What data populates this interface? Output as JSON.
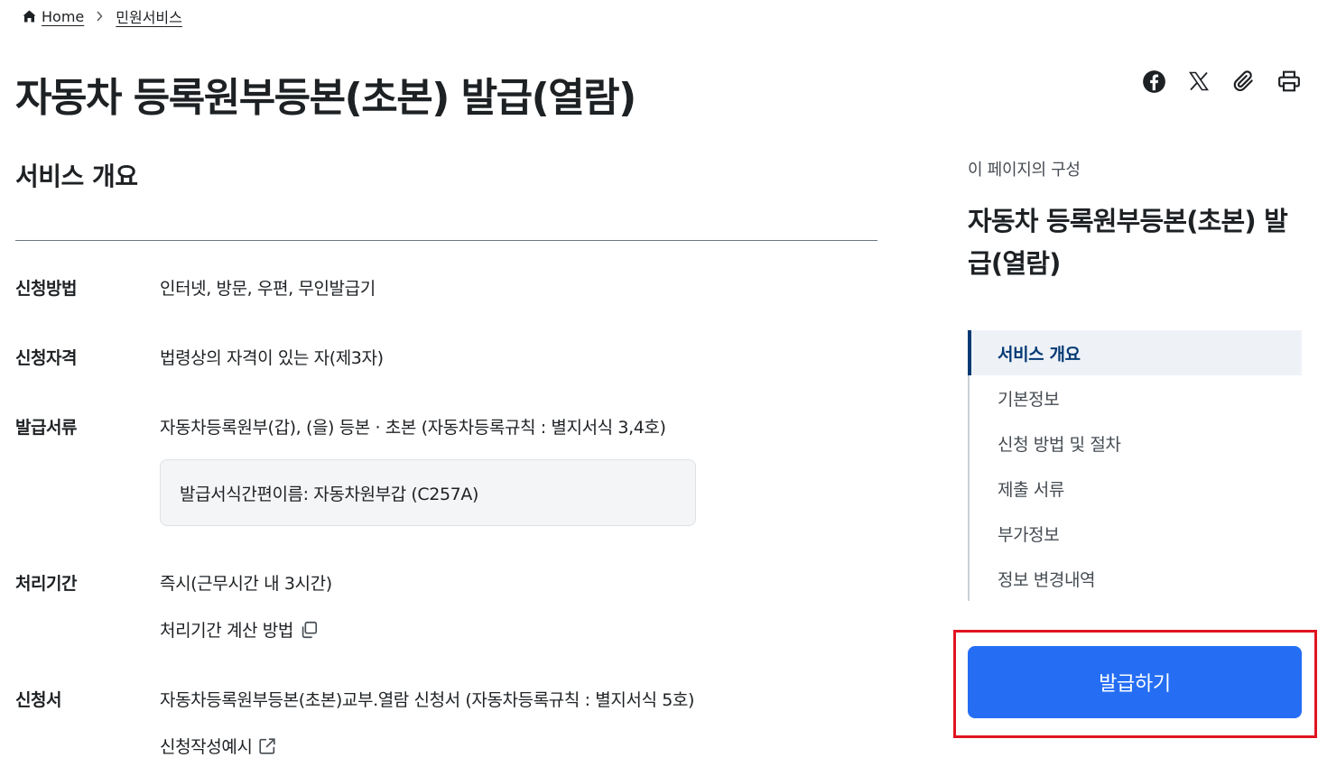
{
  "breadcrumb": {
    "home": "Home",
    "current": "민원서비스"
  },
  "page_title": "자동차 등록원부등본(초본) 발급(열람)",
  "share": {
    "icons": [
      "facebook-icon",
      "x-icon",
      "paperclip-icon",
      "print-icon"
    ]
  },
  "section": {
    "title": "서비스 개요",
    "rows": [
      {
        "label": "신청방법",
        "value": "인터넷, 방문, 우편, 무인발급기"
      },
      {
        "label": "신청자격",
        "value": "법령상의 자격이 있는 자(제3자)"
      },
      {
        "label": "발급서류",
        "value": "자동차등록원부(갑), (을) 등본 · 초본 (자동차등록규칙 : 별지서식 3,4호)"
      },
      {
        "label": "처리기간",
        "value": "즉시(근무시간 내 3시간)"
      },
      {
        "label": "신청서",
        "value": "자동차등록원부등본(초본)교부.열람 신청서 (자동차등록규칙 : 별지서식 5호)"
      }
    ],
    "form_box": "발급서식간편이름: 자동차원부갑 (C257A)",
    "processing_link": "처리기간 계산 방법",
    "example_link": "신청작성예시"
  },
  "toc": {
    "caption": "이 페이지의 구성",
    "title": "자동차 등록원부등본(초본) 발급(열람)",
    "items": [
      {
        "label": "서비스 개요",
        "active": true
      },
      {
        "label": "기본정보"
      },
      {
        "label": "신청 방법 및 절차"
      },
      {
        "label": "제출 서류"
      },
      {
        "label": "부가정보"
      },
      {
        "label": "정보 변경내역"
      }
    ]
  },
  "issue_button": "발급하기",
  "colors": {
    "primary": "#256ef4",
    "toc_active": "#063a74",
    "highlight": "#e0141f"
  }
}
